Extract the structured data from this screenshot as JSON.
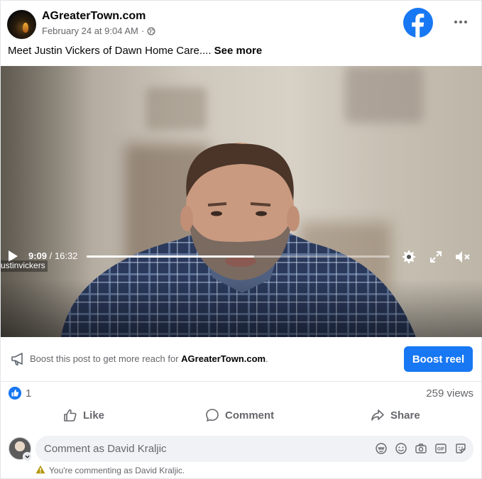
{
  "header": {
    "page_name": "AGreaterTown.com",
    "timestamp": "February 24 at 9:04 AM",
    "separator": "·",
    "privacy_icon": "globe-icon",
    "brand_icon": "facebook-logo-icon",
    "more_icon": "more-options-icon"
  },
  "caption": {
    "text": "Meet Justin Vickers of Dawn Home Care.... ",
    "see_more": "See more"
  },
  "video": {
    "current_time": "9:09",
    "time_separator": " / ",
    "duration": "16:32",
    "progress_fraction": 0.553,
    "watermark": "ustinvickers",
    "controls": [
      "play-icon",
      "settings-gear-icon",
      "fullscreen-icon",
      "mute-icon"
    ]
  },
  "boost": {
    "text_prefix": "Boost this post to get more reach for ",
    "page_name": "AGreaterTown.com",
    "text_suffix": ".",
    "button_label": "Boost reel"
  },
  "stats": {
    "like_count": "1",
    "views": "259 views"
  },
  "actions": {
    "like": "Like",
    "comment": "Comment",
    "share": "Share"
  },
  "composer": {
    "placeholder": "Comment as David Kraljic",
    "warning": "You're commenting as David Kraljic.",
    "icons": [
      "avatar-sticker-icon",
      "emoji-icon",
      "camera-icon",
      "gif-icon",
      "sticker-icon"
    ]
  },
  "colors": {
    "brand_blue": "#1877f2",
    "secondary_text": "#65676b",
    "warning_yellow": "#b3960a"
  }
}
